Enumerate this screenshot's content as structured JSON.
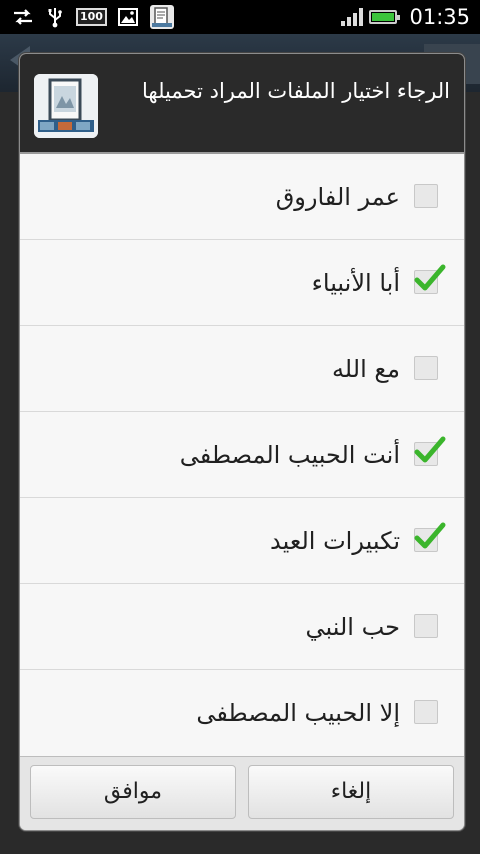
{
  "status_bar": {
    "battery_percent_badge": "100",
    "clock": "01:35",
    "icons": [
      "sync-icon",
      "usb-icon",
      "battery-badge",
      "image-icon",
      "book-icon",
      "signal-icon",
      "battery-icon"
    ]
  },
  "dialog": {
    "title": "الرجاء اختيار الملفات المراد تحميلها",
    "items": [
      {
        "label": "عمر الفاروق",
        "checked": false
      },
      {
        "label": "أبا الأنبياء",
        "checked": true
      },
      {
        "label": "مع الله",
        "checked": false
      },
      {
        "label": "أنت الحبيب المصطفى",
        "checked": true
      },
      {
        "label": "تكبيرات العيد",
        "checked": true
      },
      {
        "label": "حب النبي",
        "checked": false
      },
      {
        "label": "إلا الحبيب المصطفى",
        "checked": false
      }
    ],
    "ok_label": "موافق",
    "cancel_label": "إلغاء"
  },
  "colors": {
    "check_green": "#3bb52c",
    "battery_green": "#3cc43c",
    "header_bg": "#2a2a2a"
  }
}
